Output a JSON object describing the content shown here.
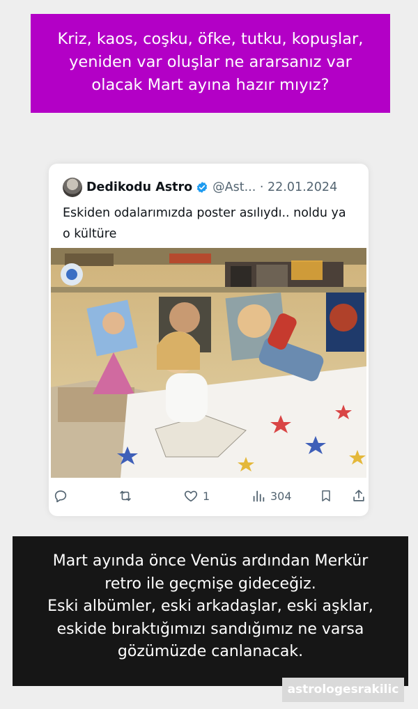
{
  "top_caption": "Kriz, kaos, coşku, öfke, tutku, kopuşlar,\nyeniden var oluşlar ne ararsanız var\nolacak Mart ayına hazır mıyız?",
  "tweet": {
    "author_name": "Dedikodu Astro",
    "handle_date": "@Ast... · 22.01.2024",
    "text": "Eskiden odalarımızda poster asılıydı.. noldu ya o kültüre",
    "photo_icon": "bedroom-photo",
    "actions": {
      "reply_icon": "reply-icon",
      "retweet_icon": "retweet-icon",
      "like_icon": "heart-icon",
      "like_count": "1",
      "views_icon": "views-icon",
      "view_count": "304",
      "bookmark_icon": "bookmark-icon",
      "share_icon": "share-icon"
    },
    "verified_color": "#1d9bf0"
  },
  "bottom_caption": "Mart ayında önce Venüs ardından Merkür\nretro ile geçmişe gideceğiz.\nEski albümler, eski arkadaşlar, eski aşklar,\neskide bıraktığımızı sandığımız ne varsa\ngözümüzde canlanacak.",
  "watermark": "astrologesrakilic",
  "colors": {
    "top_banner": "#b300c6",
    "bottom_banner": "#161616",
    "background": "#eeeeee"
  }
}
